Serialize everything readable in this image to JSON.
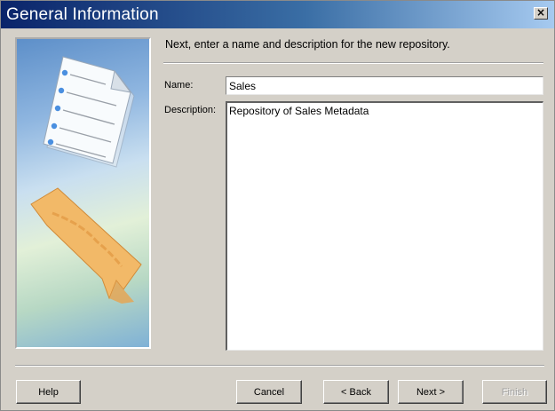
{
  "window": {
    "title": "General Information",
    "close_glyph": "×"
  },
  "wizard": {
    "instruction": "Next, enter a name and description for the new repository.",
    "name_label": "Name:",
    "name_value": "Sales",
    "description_label": "Description:",
    "description_value": "Repository of Sales Metadata"
  },
  "buttons": {
    "help": "Help",
    "cancel": "Cancel",
    "back": "< Back",
    "next": "Next >",
    "finish": "Finish"
  },
  "illustration": {
    "icons": [
      "document-icon",
      "tag-icon"
    ]
  }
}
